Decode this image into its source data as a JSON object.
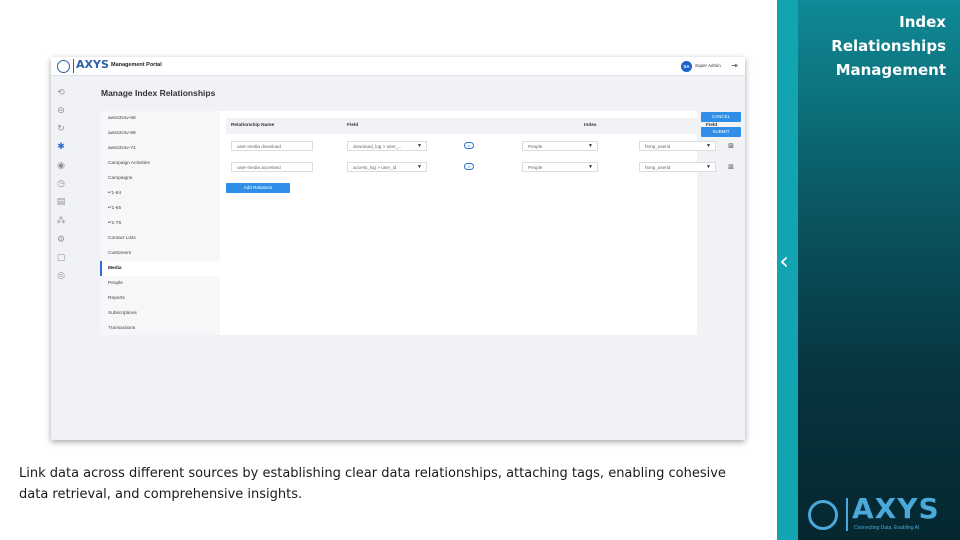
{
  "side_panel": {
    "title_lines": [
      "Index",
      "Relationships",
      "Management"
    ],
    "chevron": "‹",
    "logo_word": "AXYS",
    "logo_tagline": "Connecting Data, Enabling AI",
    "accent": "#0f8a96"
  },
  "app": {
    "logo_word": "AXYS",
    "portal_title": "Management Portal",
    "user_initials": "SA",
    "user_name": "Super Admin",
    "page_title": "Manage Index Relationships",
    "accent": "#2f8fe8"
  },
  "sources": [
    {
      "label": "awss3csv-68",
      "active": false
    },
    {
      "label": "awss3csv-69",
      "active": false
    },
    {
      "label": "awss3csv-74",
      "active": false
    },
    {
      "label": "Campaign Activities",
      "active": false
    },
    {
      "label": "Campaigns",
      "active": false
    },
    {
      "label": "•*1-64",
      "active": false
    },
    {
      "label": "•*1-65",
      "active": false
    },
    {
      "label": "•*1-75",
      "active": false
    },
    {
      "label": "Contact Lists",
      "active": false
    },
    {
      "label": "Customers",
      "active": false
    },
    {
      "label": "Media",
      "active": true
    },
    {
      "label": "People",
      "active": false
    },
    {
      "label": "Reports",
      "active": false
    },
    {
      "label": "Subscriptions",
      "active": false
    },
    {
      "label": "Transactions",
      "active": false
    }
  ],
  "table": {
    "headers": {
      "name": "Relationship Name",
      "field": "Field",
      "index": "Index",
      "field2": "Field"
    },
    "rows": [
      {
        "name": "user-media download",
        "field": "download_log > user_...",
        "index": "People",
        "target_field": "f4mp_userid"
      },
      {
        "name": "user-media accessed",
        "field": "access_log > user_id",
        "index": "People",
        "target_field": "f4mp_userid"
      }
    ],
    "add_label": "Add Relations"
  },
  "actions": {
    "cancel": "CANCEL",
    "submit": "SUBMIT"
  },
  "caption": "Link data across different sources by establishing clear data relationships, attaching tags, enabling cohesive data retrieval, and comprehensive insights."
}
